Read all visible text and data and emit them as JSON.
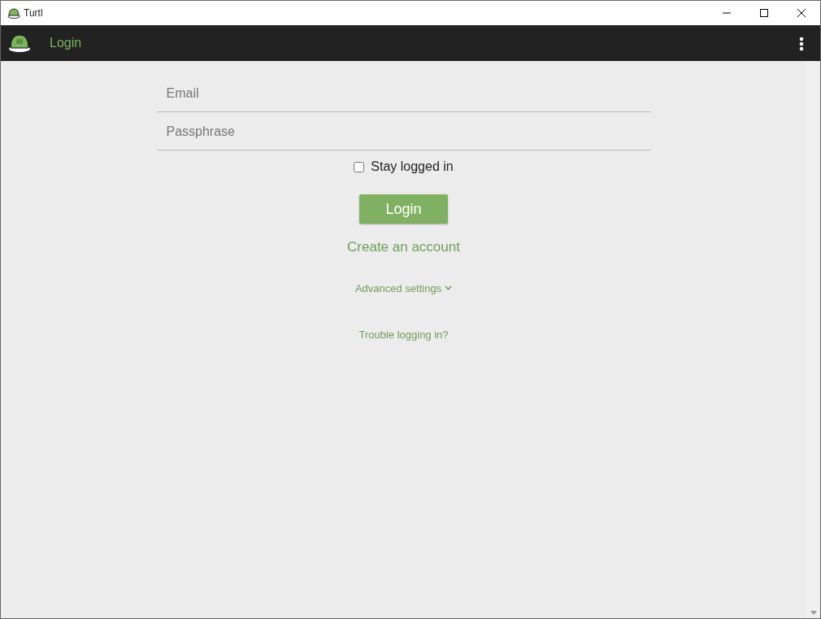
{
  "window": {
    "title": "Turtl"
  },
  "header": {
    "title": "Login"
  },
  "form": {
    "email": {
      "placeholder": "Email"
    },
    "passphrase": {
      "placeholder": "Passphrase"
    },
    "stay_logged_in": {
      "label": "Stay logged in",
      "checked": false
    },
    "login_button": "Login",
    "create_account": "Create an account",
    "advanced_settings": {
      "label": "Advanced settings",
      "expanded": false
    },
    "trouble": "Trouble logging in?"
  }
}
